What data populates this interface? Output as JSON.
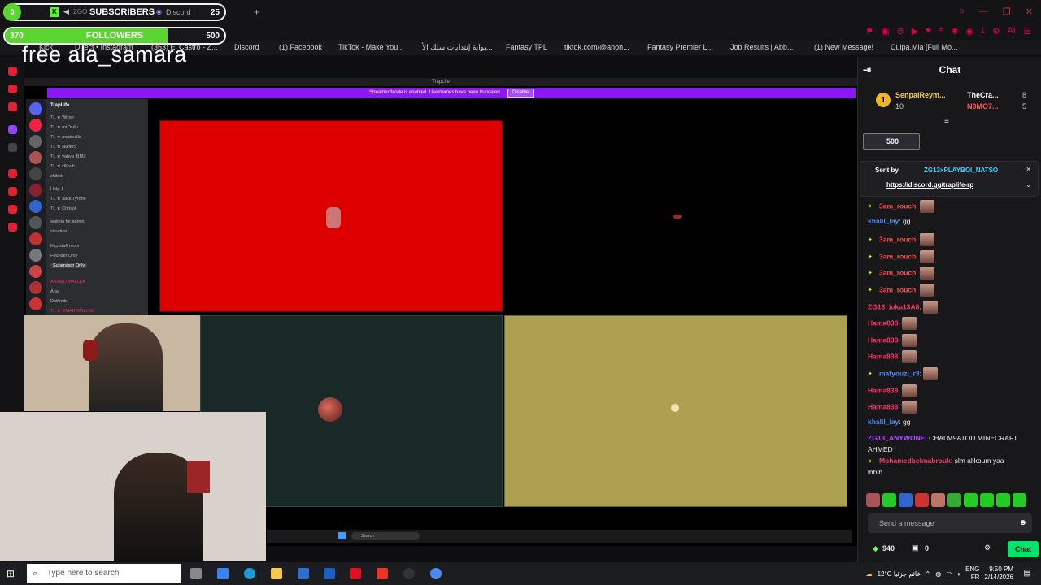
{
  "overlay": {
    "sub_count": "0",
    "sub_app": "ZGO",
    "sub_label": "SUBSCRIBERS",
    "sub_discord": "Discord",
    "sub_goal": "25",
    "follower_count": "370",
    "follower_label": "FOLLOWERS",
    "follower_goal": "500",
    "free_text": "free ala_samara"
  },
  "bookmarks": [
    "Kick",
    "Direct • Instagram",
    "(363) El Castro - Z...",
    "Discord",
    "(1) Facebook",
    "TikTok - Make You...",
    "بوابة إنتدابات سلك الأ...",
    "Fantasy TPL",
    "tiktok.com/@anon...",
    "Fantasy Premier L...",
    "Job Results | Abb...",
    "(1) New Message!",
    "Culpa.Mia [Full Mo..."
  ],
  "stream": {
    "inner_title": "TrapLife",
    "banner_text": "Streamer Mode is enabled. Usernames have been truncated.",
    "banner_button": "Disable",
    "discord_server": "TrapLife",
    "discord_channels": [
      "TL ★ Wirrer",
      "TL ★ mrOsdu",
      "TL ★ medouilla",
      "TL ★ NaNtrS",
      "TL ★ yahya_BMX",
      "TL ★ clllbub",
      "chibeb",
      "Help-1",
      "TL ★ Jack Tyrone",
      "TL ★ Chrisol",
      "waiting for admin",
      "situation",
      "tl-rp staff room",
      "Founder Only",
      "Supervisor Only",
      "AHMED MALLEK",
      "Anal",
      "Daiflmib",
      "TL ★ OMAR MALLEK"
    ],
    "taskbar_search": "Search"
  },
  "chat": {
    "title": "Chat",
    "leaders": [
      {
        "rank": "1",
        "name": "SenpaiReym...",
        "count": "10"
      },
      {
        "name": "TheCra...",
        "count": "8"
      },
      {
        "name": "N9MO7...",
        "count": "5"
      }
    ],
    "gift_amount": "500",
    "pinned": {
      "sent_by_label": "Sent by",
      "sender": "ZG13xPLAYBOI_NATSO",
      "link": "https://discord.gg/traplife-rp"
    },
    "messages": [
      {
        "user": "3am_rouch",
        "color": "#ff4a4a",
        "text": ":",
        "emote": true,
        "badge": true
      },
      {
        "user": "khalil_lay",
        "color": "#4d8cff",
        "text": ": gg",
        "emote": false,
        "badge": false
      },
      {
        "user": "3am_rouch",
        "color": "#ff4a4a",
        "text": ":",
        "emote": true,
        "badge": true
      },
      {
        "user": "3am_rouch",
        "color": "#ff4a4a",
        "text": ":",
        "emote": true,
        "badge": true
      },
      {
        "user": "3am_rouch",
        "color": "#ff4a4a",
        "text": ":",
        "emote": true,
        "badge": true
      },
      {
        "user": "3am_rouch",
        "color": "#ff4a4a",
        "text": ":",
        "emote": true,
        "badge": true
      },
      {
        "user": "ZG13_joka13A8",
        "color": "#ff3366",
        "text": ":",
        "emote": true,
        "badge": false
      },
      {
        "user": "Hama838",
        "color": "#ff3366",
        "text": ":",
        "emote": true,
        "badge": false
      },
      {
        "user": "Hama838",
        "color": "#ff3366",
        "text": ":",
        "emote": true,
        "badge": false
      },
      {
        "user": "Hama838",
        "color": "#ff3366",
        "text": ":",
        "emote": true,
        "badge": false
      },
      {
        "user": "mafyouzi_r3",
        "color": "#4d8cff",
        "text": ":",
        "emote": true,
        "badge": true
      },
      {
        "user": "Hama838",
        "color": "#ff3366",
        "text": ":",
        "emote": true,
        "badge": false
      },
      {
        "user": "Hama838",
        "color": "#ff3366",
        "text": ":",
        "emote": true,
        "badge": false
      },
      {
        "user": "khalil_lay",
        "color": "#4d8cff",
        "text": ": gg",
        "emote": false,
        "badge": false
      },
      {
        "user": "ZG13_ANYWONE",
        "color": "#b44dff",
        "text": ": CHALM9ATOU MINECRAFT",
        "emote": false,
        "badge": false
      },
      {
        "user": "",
        "color": "#efeff1",
        "text": "AHMED",
        "emote": false,
        "badge": false
      },
      {
        "user": "Mohamedbelmabrouk",
        "color": "#ff3366",
        "text": ": slm alikoum yaa",
        "emote": false,
        "badge": true
      },
      {
        "user": "",
        "color": "#efeff1",
        "text": "lhbib",
        "emote": false,
        "badge": false
      }
    ],
    "input_placeholder": "Send a message",
    "points": "940",
    "gifts": "0",
    "chat_button": "Chat"
  },
  "taskbar": {
    "search_placeholder": "Type here to search",
    "weather": "12°C  غائم جزئيا",
    "lang_top": "ENG",
    "lang_bottom": "FR",
    "time": "9:50 PM",
    "date": "2/14/2026"
  },
  "colors": {
    "accent_green": "#00e46b",
    "banner_purple": "#8d18f7",
    "tile_red": "#de0000",
    "tile_olive": "#aea051"
  }
}
